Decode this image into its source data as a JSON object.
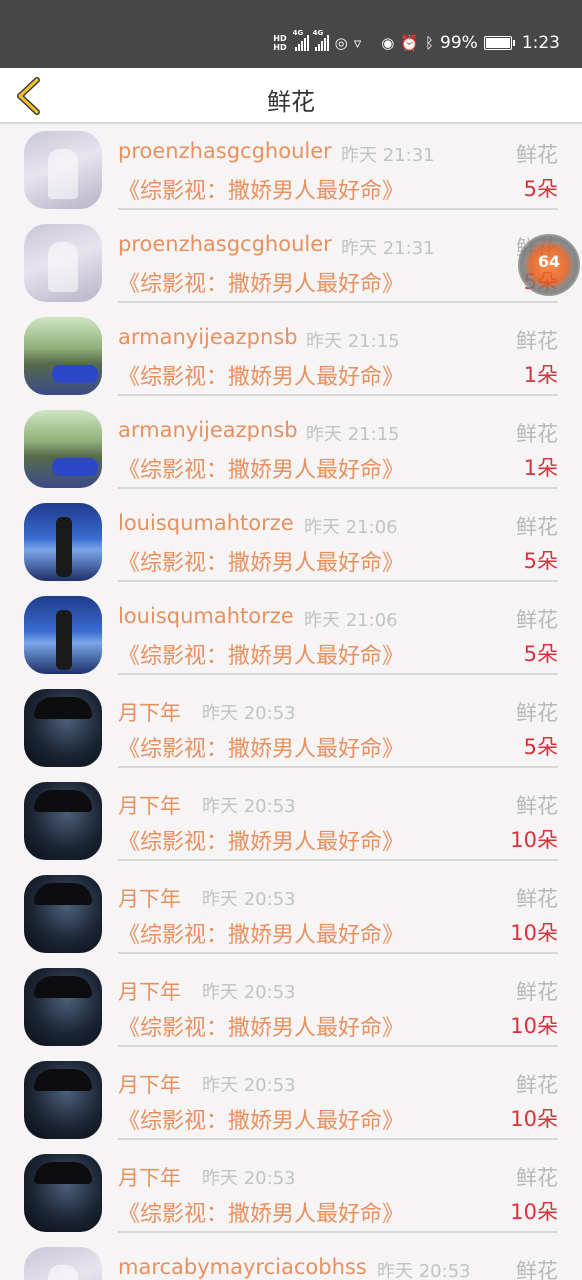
{
  "status_bar": {
    "hd1": "HD",
    "hd2": "HD",
    "net1": "4G",
    "net2": "4G",
    "battery": "99%",
    "time": "1:23"
  },
  "header": {
    "title": "鲜花"
  },
  "floating_button": {
    "label": "64"
  },
  "rows": [
    {
      "name": "proenzhasgcghouler",
      "time": "昨天 21:31",
      "gift": "鲜花",
      "book": "《综影视：撒娇男人最好命》",
      "count": "5朵",
      "avatar": "couple"
    },
    {
      "name": "proenzhasgcghouler",
      "time": "昨天 21:31",
      "gift": "鲜花",
      "book": "《综影视：撒娇男人最好命》",
      "count": "5朵",
      "avatar": "couple"
    },
    {
      "name": "armanyijeazpnsb",
      "time": "昨天 21:15",
      "gift": "鲜花",
      "book": "《综影视：撒娇男人最好命》",
      "count": "1朵",
      "avatar": "car"
    },
    {
      "name": "armanyijeazpnsb",
      "time": "昨天 21:15",
      "gift": "鲜花",
      "book": "《综影视：撒娇男人最好命》",
      "count": "1朵",
      "avatar": "car"
    },
    {
      "name": "louisqumahtorze",
      "time": "昨天 21:06",
      "gift": "鲜花",
      "book": "《综影视：撒娇男人最好命》",
      "count": "5朵",
      "avatar": "anime"
    },
    {
      "name": "louisqumahtorze",
      "time": "昨天 21:06",
      "gift": "鲜花",
      "book": "《综影视：撒娇男人最好命》",
      "count": "5朵",
      "avatar": "anime"
    },
    {
      "name": "月下年",
      "time": "昨天 20:53",
      "gift": "鲜花",
      "book": "《综影视：撒娇男人最好命》",
      "count": "5朵",
      "avatar": "hat"
    },
    {
      "name": "月下年",
      "time": "昨天 20:53",
      "gift": "鲜花",
      "book": "《综影视：撒娇男人最好命》",
      "count": "10朵",
      "avatar": "hat"
    },
    {
      "name": "月下年",
      "time": "昨天 20:53",
      "gift": "鲜花",
      "book": "《综影视：撒娇男人最好命》",
      "count": "10朵",
      "avatar": "hat"
    },
    {
      "name": "月下年",
      "time": "昨天 20:53",
      "gift": "鲜花",
      "book": "《综影视：撒娇男人最好命》",
      "count": "10朵",
      "avatar": "hat"
    },
    {
      "name": "月下年",
      "time": "昨天 20:53",
      "gift": "鲜花",
      "book": "《综影视：撒娇男人最好命》",
      "count": "10朵",
      "avatar": "hat"
    },
    {
      "name": "月下年",
      "time": "昨天 20:53",
      "gift": "鲜花",
      "book": "《综影视：撒娇男人最好命》",
      "count": "10朵",
      "avatar": "hat"
    },
    {
      "name": "marcabymayrciacobhss",
      "time": "昨天 20:53",
      "gift": "鲜花",
      "book": "",
      "count": "",
      "avatar": "couple"
    }
  ]
}
